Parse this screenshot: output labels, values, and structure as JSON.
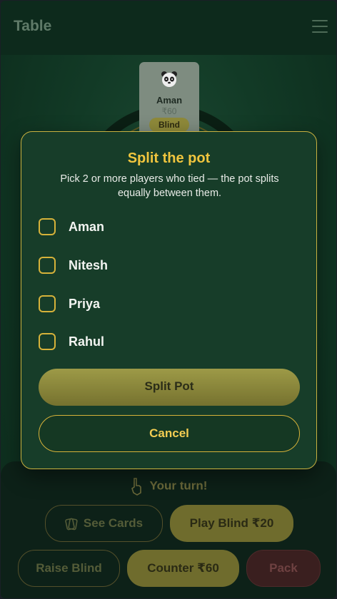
{
  "header": {
    "title": "Table"
  },
  "seat": {
    "name": "Aman",
    "chips": "₹60",
    "badge": "Blind"
  },
  "bottom": {
    "turn_text": "Your turn!",
    "see_cards": "See Cards",
    "play_blind": "Play Blind ₹20",
    "raise_blind": "Raise Blind",
    "counter": "Counter ₹60",
    "pack": "Pack"
  },
  "modal": {
    "title": "Split the pot",
    "description": "Pick 2 or more players who tied — the pot splits equally between them.",
    "players": [
      "Aman",
      "Nitesh",
      "Priya",
      "Rahul"
    ],
    "split_label": "Split Pot",
    "cancel_label": "Cancel"
  },
  "colors": {
    "accent_gold": "#f0c53e",
    "modal_bg": "#173d29",
    "modal_border": "#c9b140"
  }
}
